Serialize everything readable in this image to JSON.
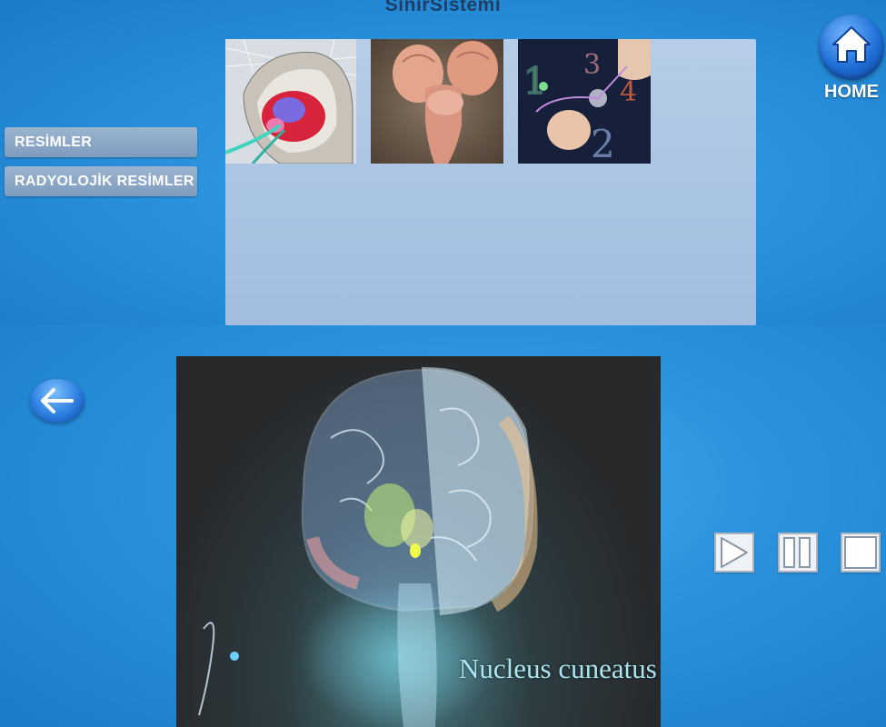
{
  "app": {
    "title": "SinirSistemi"
  },
  "home": {
    "label": "HOME",
    "icon": "home-icon"
  },
  "menu": {
    "items": [
      {
        "label": "RESİMLER"
      },
      {
        "label": "RADYOLOJİK RESİMLER"
      }
    ]
  },
  "gallery": {
    "thumbnails": [
      {
        "icon": "brain-cross-section-image"
      },
      {
        "icon": "brainstem-image"
      },
      {
        "icon": "numbered-neural-pathway-image"
      }
    ]
  },
  "navigation": {
    "back_icon": "arrow-left-icon"
  },
  "viewer": {
    "caption": "Nucleus cuneatus"
  },
  "controls": {
    "play_icon": "play-icon",
    "pause_icon": "pause-icon",
    "stop_icon": "stop-icon"
  },
  "colors": {
    "background": "#2a92dd",
    "panel": "#a9c3e3",
    "title": "#1d3f63",
    "caption": "#a9e6f1"
  }
}
